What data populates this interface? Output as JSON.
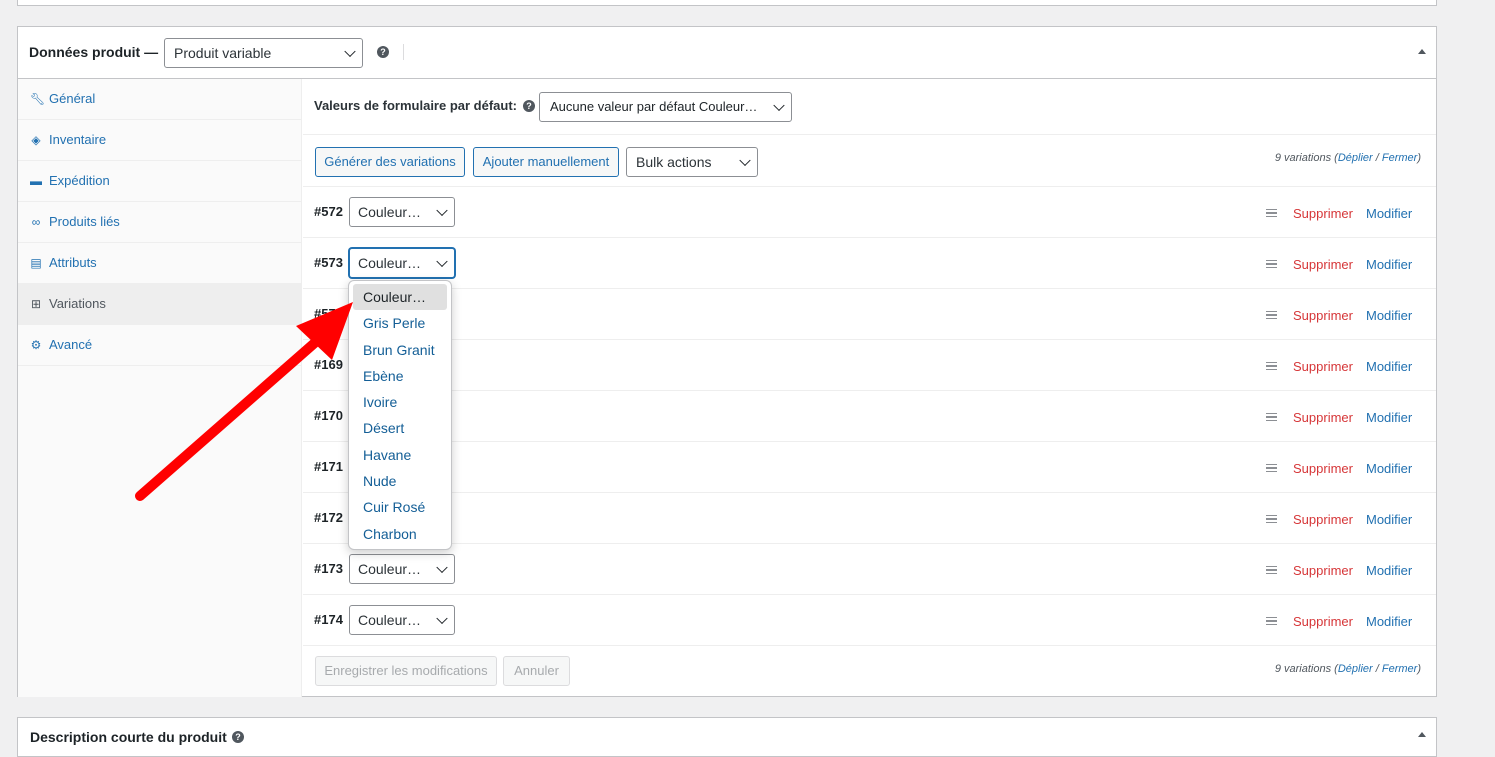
{
  "panel": {
    "title": "Données produit —",
    "product_type": "Produit variable",
    "help": "?"
  },
  "tabs": [
    {
      "label": "Général",
      "icon": "wrench-icon"
    },
    {
      "label": "Inventaire",
      "icon": "tag-icon"
    },
    {
      "label": "Expédition",
      "icon": "truck-icon"
    },
    {
      "label": "Produits liés",
      "icon": "link-icon"
    },
    {
      "label": "Attributs",
      "icon": "list-icon"
    },
    {
      "label": "Variations",
      "icon": "grid-icon",
      "active": true
    },
    {
      "label": "Avancé",
      "icon": "gear-icon"
    }
  ],
  "defaults": {
    "label": "Valeurs de formulaire par défaut:",
    "value": "Aucune valeur par défaut Couleur…"
  },
  "toolbar": {
    "generate": "Générer des variations",
    "add_manual": "Ajouter manuellement",
    "bulk": "Bulk actions",
    "count_text": "9 variations",
    "expand": "Déplier",
    "close": "Fermer"
  },
  "variations": [
    {
      "id": "#572",
      "value": "Couleur…"
    },
    {
      "id": "#573",
      "value": "Couleur…"
    },
    {
      "id": "#57",
      "value": ""
    },
    {
      "id": "#169",
      "value": ""
    },
    {
      "id": "#170",
      "value": ""
    },
    {
      "id": "#171",
      "value": ""
    },
    {
      "id": "#172",
      "value": ""
    },
    {
      "id": "#173",
      "value": "Couleur…"
    },
    {
      "id": "#174",
      "value": "Couleur…"
    }
  ],
  "row_actions": {
    "delete": "Supprimer",
    "edit": "Modifier"
  },
  "dropdown_options": [
    "Couleur…",
    "Gris Perle",
    "Brun Granit",
    "Ebène",
    "Ivoire",
    "Désert",
    "Havane",
    "Nude",
    "Cuir Rosé",
    "Charbon"
  ],
  "footer": {
    "save": "Enregistrer les modifications",
    "cancel": "Annuler",
    "count_text": "9 variations",
    "expand": "Déplier",
    "close": "Fermer"
  },
  "panel2": {
    "title": "Description courte du produit",
    "help": "?"
  },
  "colors": {
    "accent": "#2271b1",
    "danger": "#d63638",
    "arrow": "#ff0000"
  }
}
